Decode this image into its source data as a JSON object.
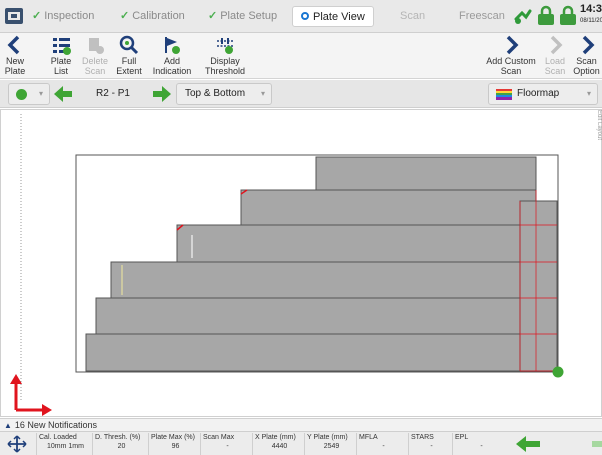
{
  "workflow_tabs": [
    {
      "label": "Inspection",
      "state": "done"
    },
    {
      "label": "Calibration",
      "state": "done"
    },
    {
      "label": "Plate Setup",
      "state": "done"
    },
    {
      "label": "Plate View",
      "state": "active"
    },
    {
      "label": "Scan",
      "state": "disabled"
    },
    {
      "label": "Freescan",
      "state": "disabled"
    }
  ],
  "clock": {
    "time": "14:3",
    "date": "08/11/20"
  },
  "toolbar": {
    "new_plate": "New Plate",
    "plate_list": "Plate List",
    "delete_scan": "Delete Scan",
    "full_extent": "Full Extent",
    "add_indication": "Add Indication",
    "display_threshold": "Display Threshold",
    "add_custom_scan": "Add Custom Scan",
    "load_scan": "Load Scan",
    "scan_option": "Scan Option"
  },
  "selectors": {
    "plate": "R2 - P1",
    "surface": "Top & Bottom",
    "view_mode": "Floormap"
  },
  "side_label": "Edit Layout",
  "notifications": {
    "text": "16 New Notifications"
  },
  "status": [
    {
      "label": "Cal. Loaded",
      "value": "10mm 1mm"
    },
    {
      "label": "D. Thresh. (%)",
      "value": "20"
    },
    {
      "label": "Plate Max (%)",
      "value": "96"
    },
    {
      "label": "Scan Max",
      "value": "-"
    },
    {
      "label": "X Plate (mm)",
      "value": "4440"
    },
    {
      "label": "Y Plate (mm)",
      "value": "2549"
    },
    {
      "label": "MFLA",
      "value": "-"
    },
    {
      "label": "STARS",
      "value": "-"
    },
    {
      "label": "EPL",
      "value": "-"
    }
  ],
  "colors": {
    "accent_blue": "#1976d2",
    "nav_green": "#3fa535",
    "scan_fill": "#a7a7a7",
    "axis_red": "#e0141e",
    "done_check": "#4caf50"
  }
}
